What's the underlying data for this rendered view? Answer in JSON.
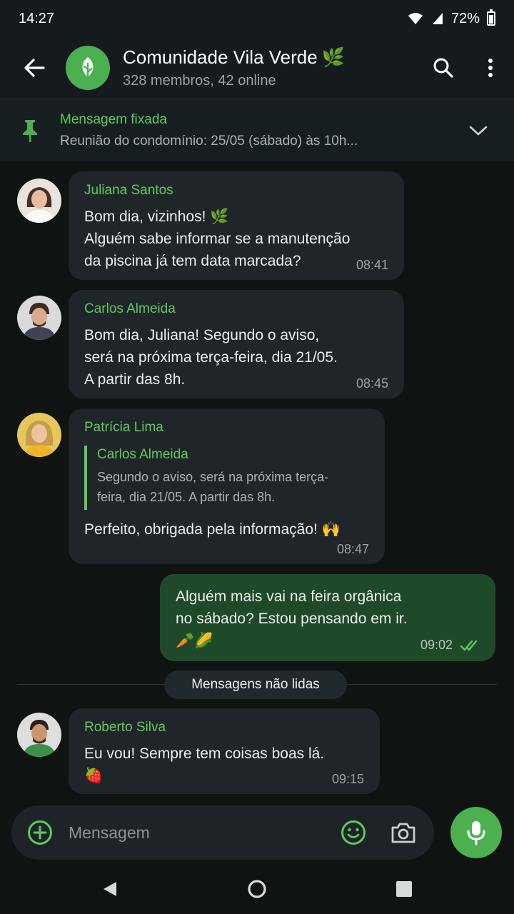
{
  "status": {
    "time": "14:27",
    "battery": "72%"
  },
  "header": {
    "title": "Comunidade Vila Verde",
    "title_emoji": "🌿",
    "subtitle": "328 membros, 42 online"
  },
  "pinned": {
    "title": "Mensagem fixada",
    "text": "Reunião do condomínio: 25/05 (sábado) às 10h..."
  },
  "messages": [
    {
      "sender": "Juliana Santos",
      "lines": [
        "Bom dia, vizinhos! 🌿",
        "Alguém sabe informar se a manutenção",
        "da piscina já tem data marcada?"
      ],
      "time": "08:41"
    },
    {
      "sender": "Carlos Almeida",
      "lines": [
        "Bom dia, Juliana! Segundo o aviso,",
        "será na próxima terça-feira, dia 21/05.",
        "A partir das 8h."
      ],
      "time": "08:45"
    },
    {
      "sender": "Patrícia Lima",
      "quote_sender": "Carlos Almeida",
      "quote_lines": [
        "Segundo o aviso, será na próxima terça-",
        "feira, dia 21/05. A partir das 8h."
      ],
      "text": "Perfeito, obrigada pela informação! 🙌",
      "time": "08:47"
    },
    {
      "lines": [
        "Alguém mais vai na feira orgânica",
        "no sábado? Estou pensando em ir.",
        "🥕🌽"
      ],
      "time": "09:02"
    },
    {
      "sender": "Roberto Silva",
      "lines": [
        "Eu vou! Sempre tem coisas boas lá.",
        "🍓"
      ],
      "time": "09:15"
    }
  ],
  "unread_label": "Mensagens não lidas",
  "composer": {
    "placeholder": "Mensagem"
  },
  "colors": {
    "accent": "#4caf50",
    "accent_text": "#5ec95b",
    "outgoing_bubble": "#1f4a2a",
    "incoming_bubble": "#1f2529"
  }
}
